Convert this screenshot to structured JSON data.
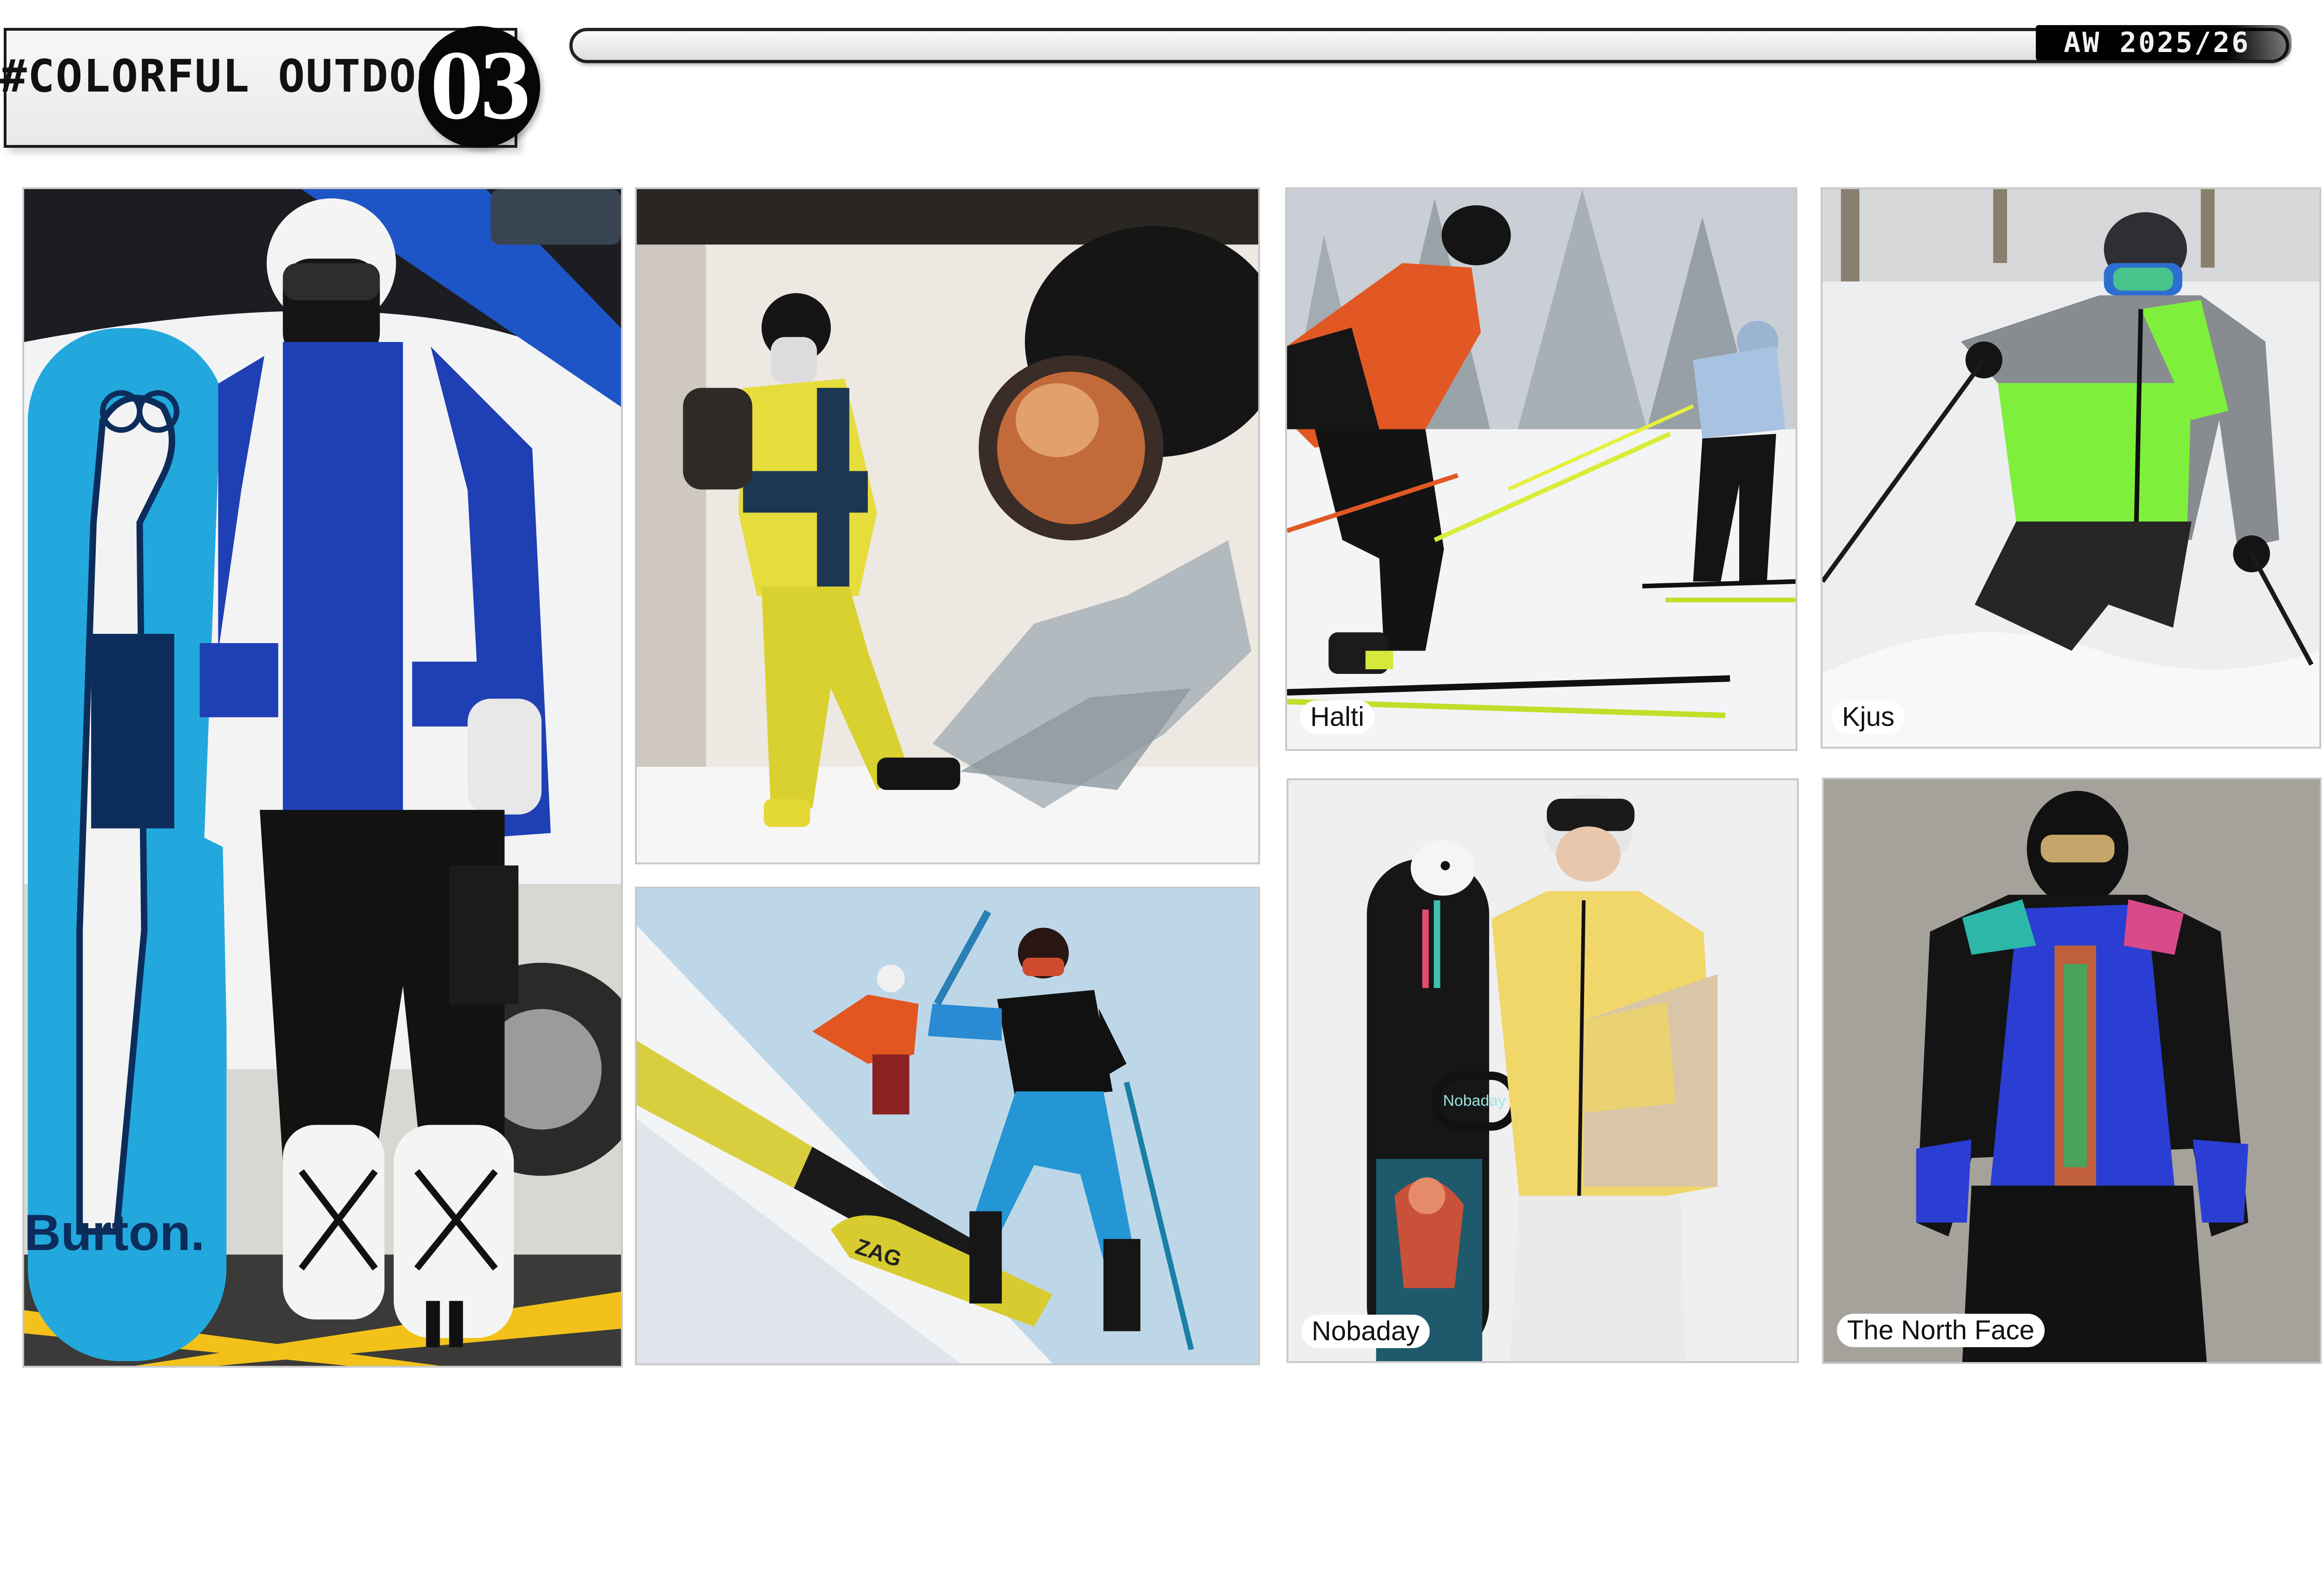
{
  "header": {
    "title": "#COLORFUL OUTDOOR",
    "number": "03",
    "season": "AW 2025/26"
  },
  "photos": [
    {
      "id": "burton-snowboard",
      "label": "",
      "board_text": "Burton."
    },
    {
      "id": "store-window-mannequin",
      "label": ""
    },
    {
      "id": "mountain-climbers",
      "label": "",
      "ski_text": "ZAG"
    },
    {
      "id": "halti",
      "label": "Halti"
    },
    {
      "id": "kjus",
      "label": "Kjus"
    },
    {
      "id": "nobaday",
      "label": "Nobaday",
      "board_text": "Nobaday"
    },
    {
      "id": "the-north-face",
      "label": "The North Face"
    }
  ],
  "colors": {
    "accent_blue": "#1f3fb4",
    "cyan": "#22a8dc",
    "yellow": "#e3d33a",
    "orange": "#e2561f",
    "neon_green": "#7ef03b",
    "black": "#0a0a0a"
  }
}
